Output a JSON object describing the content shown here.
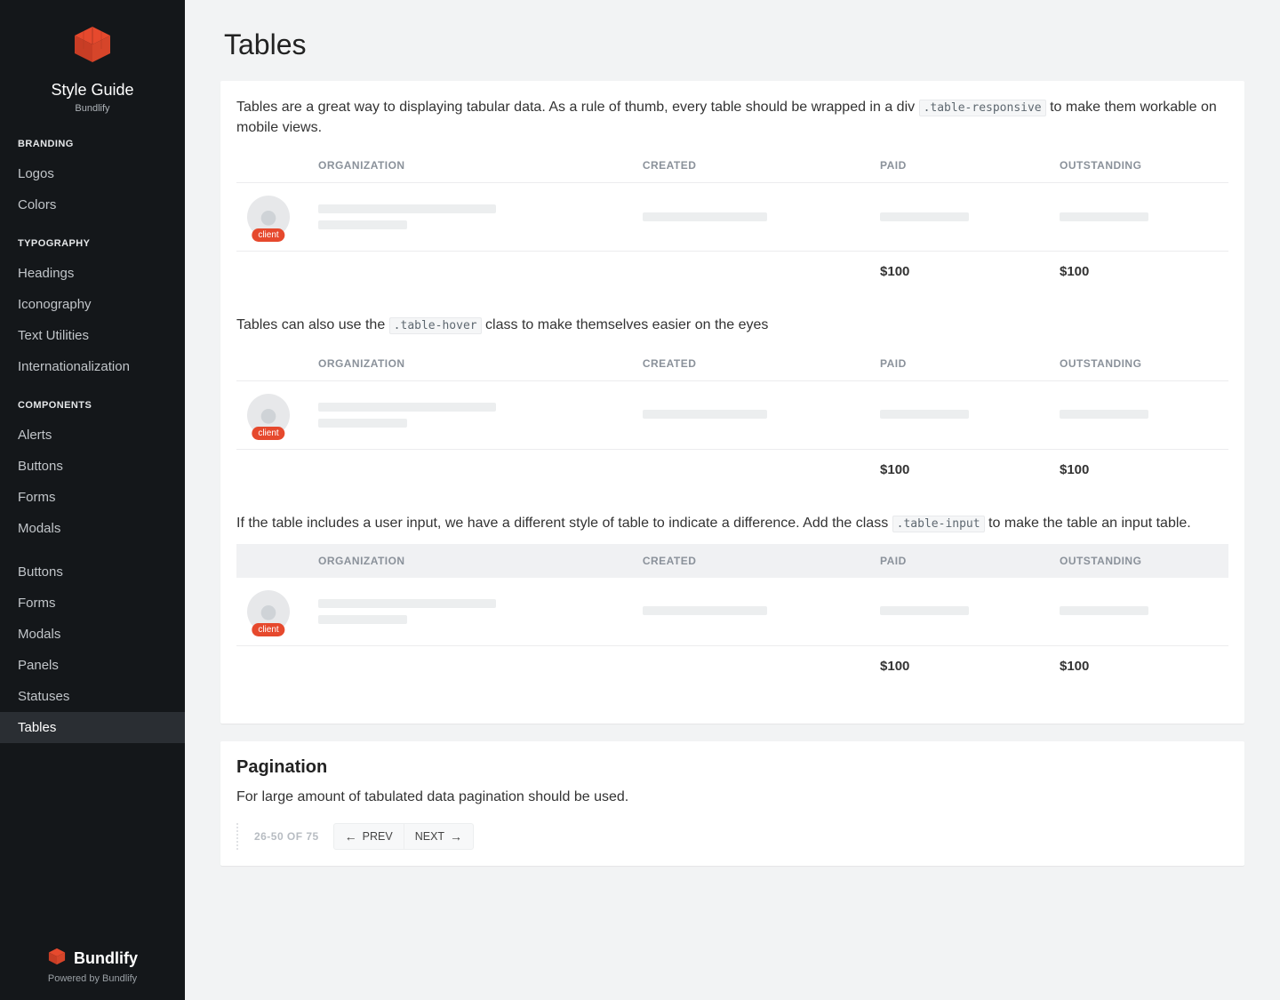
{
  "sidebar": {
    "title": "Style Guide",
    "subtitle": "Bundlify",
    "sections": [
      {
        "label": "BRANDING",
        "items": [
          "Logos",
          "Colors"
        ]
      },
      {
        "label": "TYPOGRAPHY",
        "items": [
          "Headings",
          "Iconography",
          "Text Utilities",
          "Internationalization"
        ]
      },
      {
        "label": "COMPONENTS",
        "items": [
          "Alerts",
          "Buttons",
          "Forms",
          "Modals"
        ]
      },
      {
        "label": "",
        "items": [
          "Buttons",
          "Forms",
          "Modals",
          "Panels",
          "Statuses",
          "Tables"
        ]
      }
    ],
    "active_item": "Tables",
    "footer": {
      "name": "Bundlify",
      "powered": "Powered by Bundlify"
    }
  },
  "page": {
    "title": "Tables"
  },
  "table_columns": [
    "ORGANIZATION",
    "CREATED",
    "PAID",
    "OUTSTANDING"
  ],
  "intro": {
    "pre": "Tables are a great way to displaying tabular data. As a rule of thumb, every table should be wrapped in a div ",
    "code": ".table-responsive",
    "post": " to make them workable on mobile views."
  },
  "hover_intro": {
    "pre": "Tables can also use the ",
    "code": ".table-hover",
    "post": " class to make themselves easier on the eyes"
  },
  "input_intro": {
    "pre": "If the table includes a user input, we have a different style of table to indicate a difference. Add the class ",
    "code": ".table-input",
    "post": " to make the table an input table."
  },
  "client_tag": "client",
  "footer_row": {
    "paid": "$100",
    "outstanding": "$100"
  },
  "pagination": {
    "heading": "Pagination",
    "text": "For large amount of tabulated data pagination should be used.",
    "status": "26-50 OF 75",
    "prev": "PREV",
    "next": "NEXT"
  }
}
